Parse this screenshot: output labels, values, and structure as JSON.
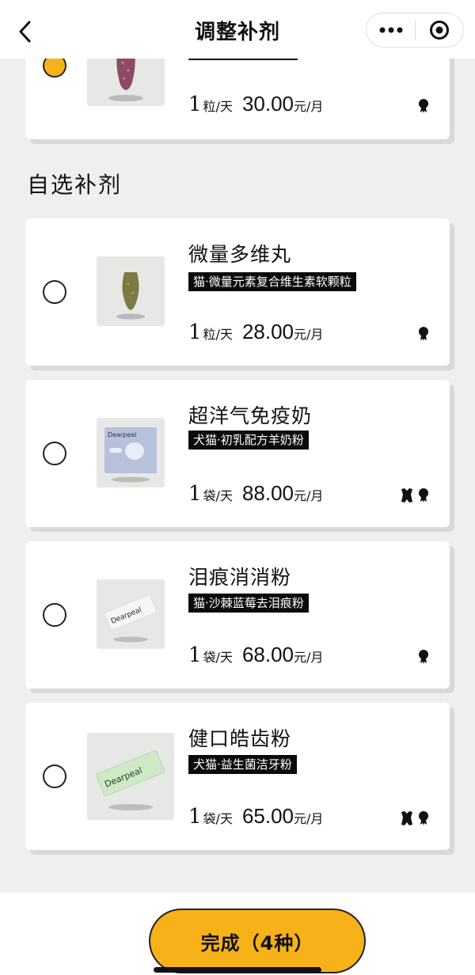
{
  "header": {
    "title": "调整补剂",
    "back_icon": "chevron-left-icon",
    "more_icon": "more-dots-icon",
    "target_icon": "target-icon"
  },
  "top_card": {
    "selected": true,
    "qty": "1",
    "qty_unit": "粒/天",
    "amount": "30.00",
    "amount_unit": "元/月",
    "species": [
      "cat"
    ]
  },
  "section": {
    "title": "自选补剂"
  },
  "items": [
    {
      "name": "微量多维丸",
      "tag": "猫·微量元素复合维生素软颗粒",
      "qty": "1",
      "qty_unit": "粒/天",
      "amount": "28.00",
      "amount_unit": "元/月",
      "species": [
        "cat"
      ]
    },
    {
      "name": "超洋气免疫奶",
      "tag": "犬猫·初乳配方羊奶粉",
      "qty": "1",
      "qty_unit": "袋/天",
      "amount": "88.00",
      "amount_unit": "元/月",
      "species": [
        "dog",
        "cat"
      ]
    },
    {
      "name": "泪痕消消粉",
      "tag": "猫·沙棘蓝莓去泪痕粉",
      "qty": "1",
      "qty_unit": "袋/天",
      "amount": "68.00",
      "amount_unit": "元/月",
      "species": [
        "cat"
      ]
    },
    {
      "name": "健口皓齿粉",
      "tag": "犬猫·益生菌洁牙粉",
      "qty": "1",
      "qty_unit": "袋/天",
      "amount": "65.00",
      "amount_unit": "元/月",
      "species": [
        "dog",
        "cat"
      ]
    }
  ],
  "product_brand": "Dearpeal",
  "footer": {
    "done_label": "完成（4种）"
  },
  "colors": {
    "accent": "#f7b21a",
    "tag_bg": "#0b0b0b",
    "page_bg": "#efefef"
  }
}
